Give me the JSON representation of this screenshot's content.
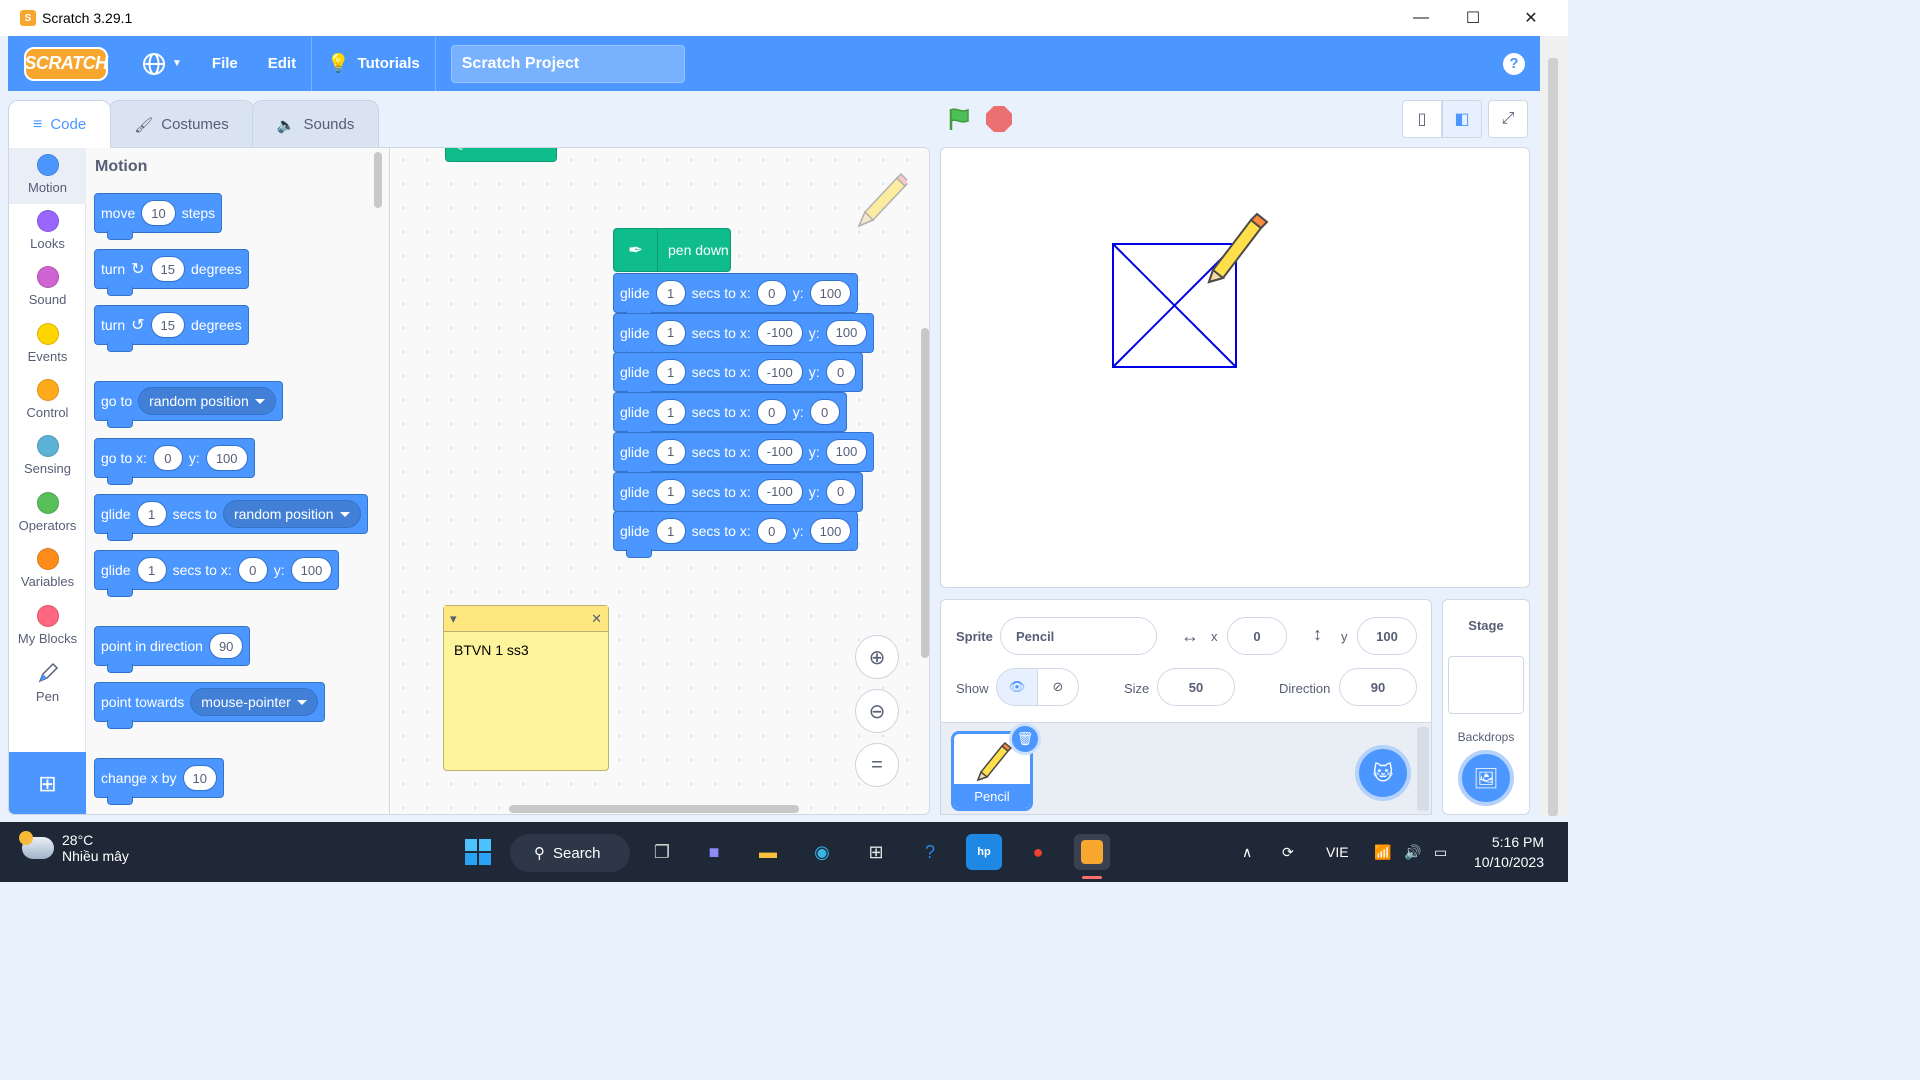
{
  "window": {
    "title": "Scratch 3.29.1"
  },
  "menubar": {
    "logo": "SCRATCH",
    "file": "File",
    "edit": "Edit",
    "tutorials": "Tutorials",
    "project_title": "Scratch Project",
    "help": "?"
  },
  "tabs": {
    "code": "Code",
    "costumes": "Costumes",
    "sounds": "Sounds"
  },
  "categories": [
    {
      "label": "Motion",
      "color": "#4c97ff"
    },
    {
      "label": "Looks",
      "color": "#9966ff"
    },
    {
      "label": "Sound",
      "color": "#cf63cf"
    },
    {
      "label": "Events",
      "color": "#ffd500"
    },
    {
      "label": "Control",
      "color": "#ffab19"
    },
    {
      "label": "Sensing",
      "color": "#5cb1d6"
    },
    {
      "label": "Operators",
      "color": "#59c059"
    },
    {
      "label": "Variables",
      "color": "#ff8c1a"
    },
    {
      "label": "My Blocks",
      "color": "#ff6680"
    },
    {
      "label": "Pen",
      "color": "#0fbd8c"
    }
  ],
  "palette": {
    "title": "Motion",
    "move": {
      "a": "move",
      "v": "10",
      "b": "steps"
    },
    "turn_cw": {
      "a": "turn",
      "v": "15",
      "b": "degrees"
    },
    "turn_ccw": {
      "a": "turn",
      "v": "15",
      "b": "degrees"
    },
    "goto": {
      "a": "go to",
      "drop": "random position"
    },
    "gotoxy": {
      "a": "go to x:",
      "x": "0",
      "y_lbl": "y:",
      "y": "100"
    },
    "glide_to": {
      "a": "glide",
      "v": "1",
      "b": "secs to",
      "drop": "random position"
    },
    "glide_xy": {
      "a": "glide",
      "v": "1",
      "b": "secs to x:",
      "x": "0",
      "y_lbl": "y:",
      "y": "100"
    },
    "point_dir": {
      "a": "point in direction",
      "v": "90"
    },
    "point_towards": {
      "a": "point towards",
      "drop": "mouse-pointer"
    },
    "change_x": {
      "a": "change x by",
      "v": "10"
    }
  },
  "script": {
    "pen_down": "pen down",
    "glide_label": "glide",
    "secs_label": "secs to x:",
    "y_label": "y:",
    "glides": [
      {
        "secs": "1",
        "x": "0",
        "y": "100"
      },
      {
        "secs": "1",
        "x": "-100",
        "y": "100"
      },
      {
        "secs": "1",
        "x": "-100",
        "y": "0"
      },
      {
        "secs": "1",
        "x": "0",
        "y": "0"
      },
      {
        "secs": "1",
        "x": "-100",
        "y": "100"
      },
      {
        "secs": "1",
        "x": "-100",
        "y": "0"
      },
      {
        "secs": "1",
        "x": "0",
        "y": "100"
      }
    ],
    "comment": "BTVN 1 ss3"
  },
  "sprite_info": {
    "sprite_label": "Sprite",
    "sprite_name": "Pencil",
    "x_label": "x",
    "x": "0",
    "y_label": "y",
    "y": "100",
    "show_label": "Show",
    "size_label": "Size",
    "size": "50",
    "direction_label": "Direction",
    "direction": "90"
  },
  "sprites": [
    {
      "name": "Pencil"
    }
  ],
  "stage_panel": {
    "title": "Stage",
    "backdrops": "Backdrops"
  },
  "taskbar": {
    "temp": "28°C",
    "weather": "Nhiều mây",
    "search": "Search",
    "lang": "VIE",
    "time": "5:16 PM",
    "date": "10/10/2023"
  }
}
